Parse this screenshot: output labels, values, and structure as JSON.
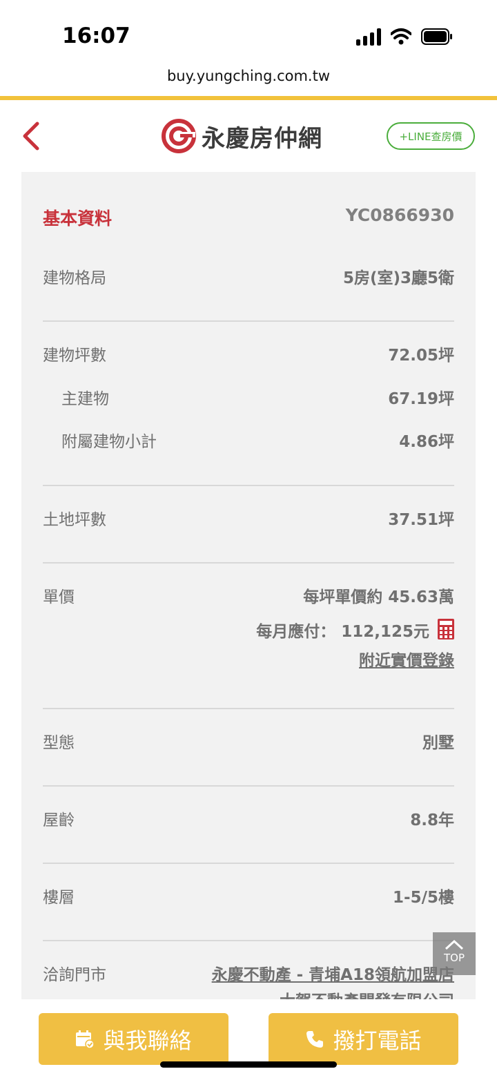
{
  "status_bar": {
    "time": "16:07"
  },
  "browser": {
    "url": "buy.yungching.com.tw"
  },
  "header": {
    "logo_text": "永慶房仲網",
    "line_button": "+LINE查房價"
  },
  "info": {
    "section_title": "基本資料",
    "listing_code": "YC0866930",
    "rows": [
      {
        "label": "建物格局",
        "value": "5房(室)3廳5衛"
      },
      {
        "label": "建物坪數",
        "value": "72.05坪"
      },
      {
        "label": "主建物",
        "value": "67.19坪"
      },
      {
        "label": "附屬建物小計",
        "value": "4.86坪"
      },
      {
        "label": "土地坪數",
        "value": "37.51坪"
      },
      {
        "label": "單價",
        "value": "每坪單價約 45.63萬"
      },
      {
        "label": "型態",
        "value": "別墅"
      },
      {
        "label": "屋齡",
        "value": "8.8年"
      },
      {
        "label": "樓層",
        "value": "1-5/5樓"
      },
      {
        "label": "洽詢門市",
        "value": "永慶不動產 - 青埔A18領航加盟店"
      }
    ],
    "monthly_payment": "每月應付： 112,125元",
    "nearby_link": "附近實價登錄",
    "store_company": "大賀不動產開發有限公司"
  },
  "top_button": "TOP",
  "bottom": {
    "contact_label": "與我聯絡",
    "call_label": "撥打電話"
  },
  "colors": {
    "accent_yellow": "#f2c23b",
    "brand_red": "#c8323b",
    "line_green": "#4aad3b",
    "button_yellow": "#f0bf43"
  },
  "icons": [
    "back-chevron-icon",
    "logo-mark-icon",
    "calculator-icon",
    "chevron-up-icon",
    "calendar-check-icon",
    "phone-icon"
  ]
}
